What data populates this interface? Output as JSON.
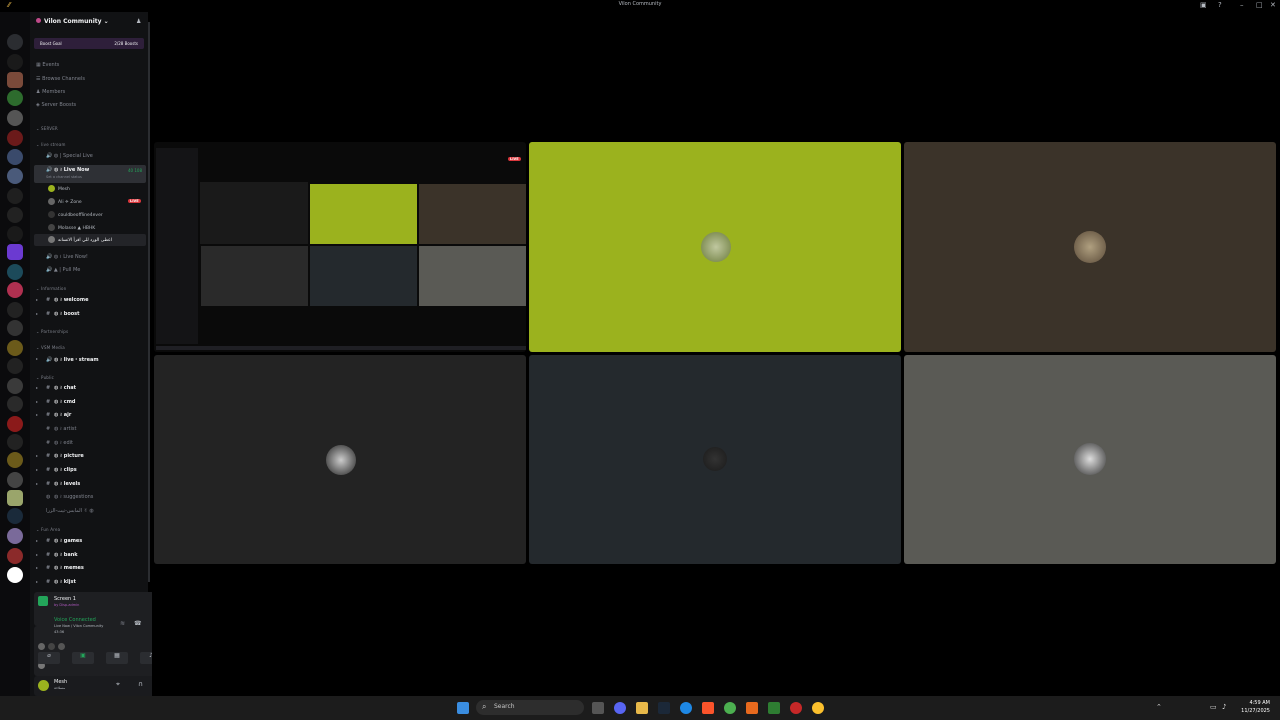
{
  "window": {
    "title": "Vilon Community"
  },
  "server": {
    "name": "Vilon Community",
    "boost_goal": {
      "label": "Boost Goal",
      "count": "2/28 Boosts"
    },
    "nav": [
      "Events",
      "Browse Channels",
      "Members",
      "Server Boosts"
    ],
    "cat_server": "SERVER",
    "cat_live": "live stream",
    "ch_special_live": "Special Live",
    "ch_live_now": "Live Now",
    "ch_status": "Set a channel status",
    "voice_count": "40 108",
    "members": [
      {
        "name": "Mesh",
        "live": "LIVE"
      },
      {
        "name": "Ali",
        "extra": "Zone"
      },
      {
        "name": "couldbeoffline4ever"
      },
      {
        "name": "Molasse",
        "extra": "HBHK"
      },
      {
        "name": "اعطى الورد للي اقرأ الانسانه"
      }
    ],
    "ch_live_now2": "Live Now!",
    "ch_pull_me": "Pull Me",
    "cat_information": "Information",
    "ch_welcome": "welcome",
    "ch_boost": "boost",
    "cat_partnerships": "Partnerships",
    "cat_vsm": "VSM Media",
    "ch_live_stream": "live・stream",
    "cat_public": "Public",
    "public_channels": [
      "chat",
      "cmd",
      "ajr",
      "artist",
      "edit",
      "picture",
      "clips",
      "levels",
      "suggestions",
      "المابس-تيت-الزرا"
    ],
    "cat_fun": "Fun Area",
    "fun_channels": [
      "games",
      "bank",
      "memes",
      "kljst"
    ]
  },
  "stream_panel": {
    "title": "Screen 1",
    "sub": "by Disp-admin"
  },
  "voice_panel": {
    "status": "Voice Connected",
    "location": "Live Now / Vilon Community",
    "time": "43:36"
  },
  "user_panel": {
    "name": "Mesh",
    "status": "مسلاحة"
  },
  "stage": {
    "live_badge": "LIVE"
  },
  "taskbar": {
    "search_placeholder": "Search",
    "time": "4:59 AM",
    "date": "11/27/2025"
  },
  "colors": {
    "lime_tile": "#9bb21e",
    "brown_tile": "#3b3329",
    "dark_tile": "#24292d",
    "gray_tile": "#5a5a55",
    "live_red": "#da373c"
  }
}
